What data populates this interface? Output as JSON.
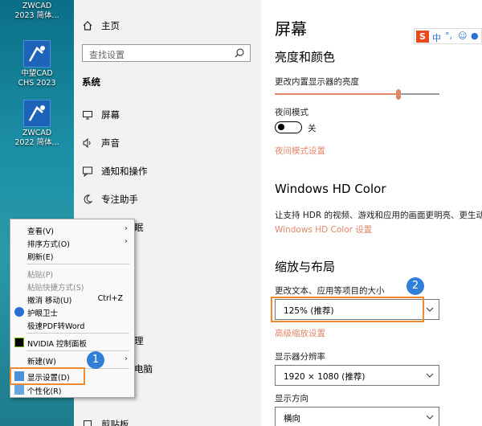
{
  "desktop": {
    "icons": [
      {
        "line1": "ZWCAD",
        "line2": "2023 简体..."
      },
      {
        "line1": "中望CAD",
        "line2": "CHS 2023"
      },
      {
        "line1": "ZWCAD",
        "line2": "2022 简体..."
      }
    ]
  },
  "sidebar": {
    "home": "主页",
    "search_placeholder": "查找设置",
    "section": "系统",
    "items": [
      {
        "label": "屏幕",
        "icon": "monitor-icon"
      },
      {
        "label": "声音",
        "icon": "speaker-icon"
      },
      {
        "label": "通知和操作",
        "icon": "notification-icon"
      },
      {
        "label": "专注助手",
        "icon": "moon-icon"
      }
    ],
    "partial": [
      "眠",
      "理",
      "电脑",
      "剪贴板"
    ]
  },
  "main": {
    "title": "屏幕",
    "brightness_heading": "亮度和颜色",
    "brightness_label": "更改内置显示器的亮度",
    "brightness_value": 0.75,
    "night_label": "夜间模式",
    "night_state": "关",
    "night_link": "夜间模式设置",
    "hd_heading": "Windows HD Color",
    "hd_desc": "让支持 HDR 的视频、游戏和应用的画面更明亮、更生动。",
    "hd_link": "Windows HD Color 设置",
    "scale_heading": "缩放与布局",
    "scale_label": "更改文本、应用等项目的大小",
    "scale_value": "125% (推荐)",
    "scale_link": "高级缩放设置",
    "res_label": "显示器分辨率",
    "res_value": "1920 × 1080 (推荐)",
    "orient_label": "显示方向",
    "orient_value": "横向"
  },
  "context_menu": {
    "items": [
      {
        "label": "查看(V)",
        "arrow": true
      },
      {
        "label": "排序方式(O)",
        "arrow": true
      },
      {
        "label": "刷新(E)"
      },
      {
        "label": "粘贴(P)",
        "disabled": true
      },
      {
        "label": "粘贴快捷方式(S)",
        "disabled": true
      },
      {
        "label": "撤消 移动(U)",
        "shortcut": "Ctrl+Z"
      },
      {
        "label": "护眼卫士"
      },
      {
        "label": "极速PDF转Word"
      },
      {
        "label": "NVIDIA 控制面板"
      },
      {
        "label": "新建(W)",
        "arrow": true
      },
      {
        "label": "显示设置(D)"
      },
      {
        "label": "个性化(R)"
      }
    ]
  },
  "badges": [
    "1",
    "2"
  ],
  "ime": {
    "text": "中"
  },
  "colors": {
    "accent_link": "#e0876a",
    "highlight": "#ef8a2e",
    "badge": "#2f7fd8"
  }
}
